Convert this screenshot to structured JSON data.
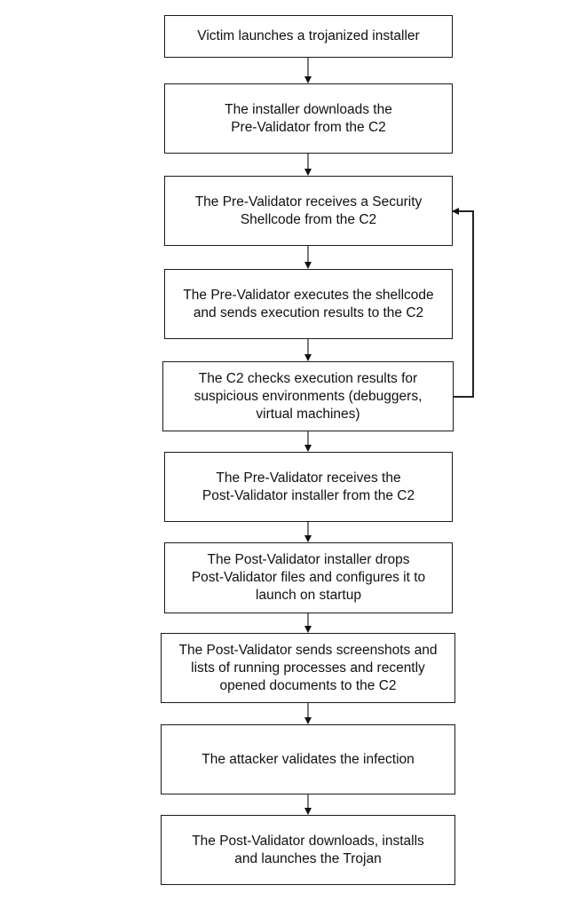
{
  "diagram": {
    "type": "flowchart",
    "steps": [
      {
        "id": "s1",
        "text": "Victim launches a trojanized installer"
      },
      {
        "id": "s2",
        "text": "The installer downloads the\nPre-Validator from the C2"
      },
      {
        "id": "s3",
        "text": "The Pre-Validator receives a Security\nShellcode from the C2"
      },
      {
        "id": "s4",
        "text": "The Pre-Validator executes the shellcode\nand sends execution results to the C2"
      },
      {
        "id": "s5",
        "text": "The C2 checks execution results for\nsuspicious environments (debuggers,\nvirtual machines)"
      },
      {
        "id": "s6",
        "text": "The Pre-Validator receives the\nPost-Validator installer from the C2"
      },
      {
        "id": "s7",
        "text": "The Post-Validator installer drops\nPost-Validator files and configures it to\nlaunch on startup"
      },
      {
        "id": "s8",
        "text": "The Post-Validator sends screenshots and\nlists of running processes and recently\nopened documents to the C2"
      },
      {
        "id": "s9",
        "text": "The attacker validates the infection"
      },
      {
        "id": "s10",
        "text": "The Post-Validator downloads, installs\nand launches the Trojan"
      }
    ],
    "edges": [
      {
        "from": "s1",
        "to": "s2"
      },
      {
        "from": "s2",
        "to": "s3"
      },
      {
        "from": "s3",
        "to": "s4"
      },
      {
        "from": "s4",
        "to": "s5"
      },
      {
        "from": "s5",
        "to": "s6"
      },
      {
        "from": "s6",
        "to": "s7"
      },
      {
        "from": "s7",
        "to": "s8"
      },
      {
        "from": "s8",
        "to": "s9"
      },
      {
        "from": "s9",
        "to": "s10"
      },
      {
        "from": "s5",
        "to": "s3",
        "kind": "loop-back"
      }
    ]
  }
}
